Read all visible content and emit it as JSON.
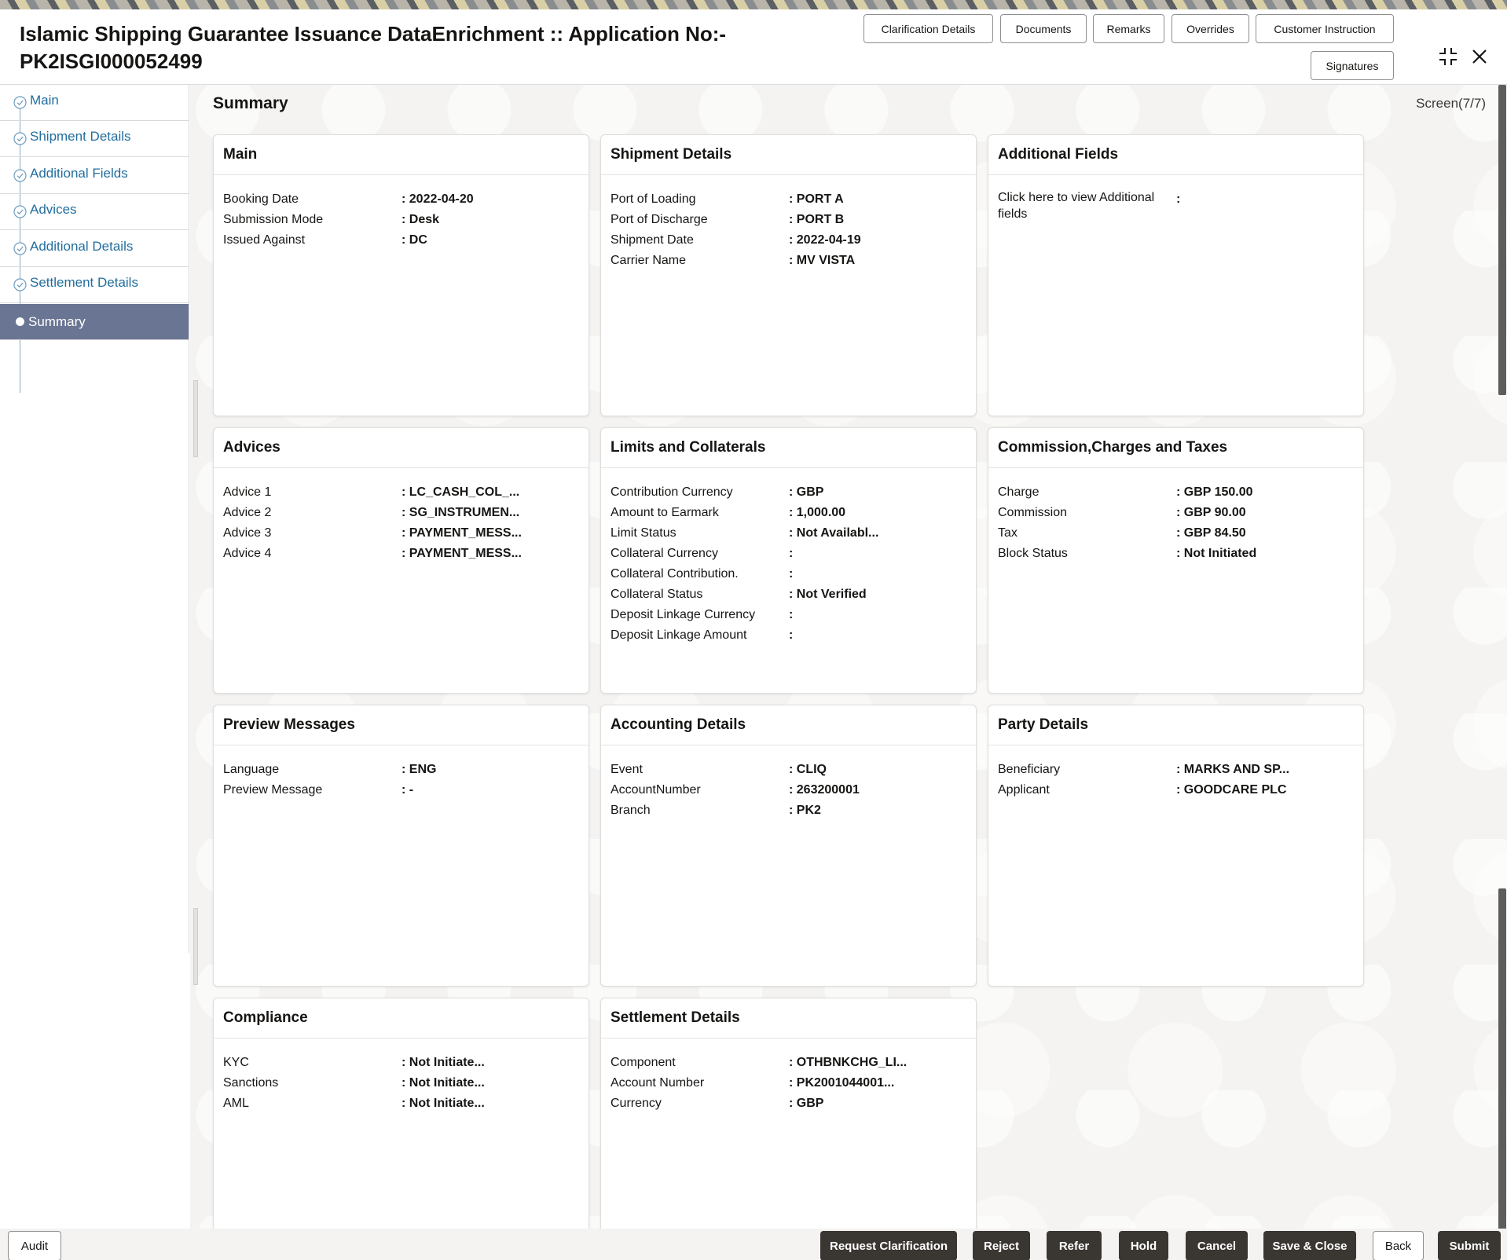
{
  "header": {
    "title_line1": "Islamic Shipping Guarantee Issuance DataEnrichment :: Application No:-",
    "title_line2": "PK2ISGI000052499",
    "buttons": {
      "clarification": "Clarification Details",
      "documents": "Documents",
      "remarks": "Remarks",
      "overrides": "Overrides",
      "customer_instruction": "Customer Instruction",
      "signatures": "Signatures"
    }
  },
  "sidebar": {
    "items": [
      {
        "label": "Main"
      },
      {
        "label": "Shipment Details"
      },
      {
        "label": "Additional Fields"
      },
      {
        "label": "Advices"
      },
      {
        "label": "Additional Details"
      },
      {
        "label": "Settlement Details"
      },
      {
        "label": "Summary"
      }
    ]
  },
  "page": {
    "title": "Summary",
    "screen_indicator": "Screen(7/7)"
  },
  "cards": {
    "main": {
      "title": "Main",
      "rows": [
        {
          "label": "Booking Date",
          "value": ": 2022-04-20"
        },
        {
          "label": "Submission Mode",
          "value": ": Desk"
        },
        {
          "label": "Issued Against",
          "value": ": DC"
        }
      ]
    },
    "shipment": {
      "title": "Shipment Details",
      "rows": [
        {
          "label": "Port of Loading",
          "value": ": PORT A"
        },
        {
          "label": "Port of Discharge",
          "value": ": PORT B"
        },
        {
          "label": "Shipment Date",
          "value": ": 2022-04-19"
        },
        {
          "label": "Carrier Name",
          "value": ": MV VISTA"
        }
      ]
    },
    "additional_fields": {
      "title": "Additional Fields",
      "rows": [
        {
          "label": "Click here to view Additional fields",
          "value": ":"
        }
      ]
    },
    "advices": {
      "title": "Advices",
      "rows": [
        {
          "label": "Advice 1",
          "value": ": LC_CASH_COL_..."
        },
        {
          "label": "Advice 2",
          "value": ": SG_INSTRUMEN..."
        },
        {
          "label": "Advice 3",
          "value": ": PAYMENT_MESS..."
        },
        {
          "label": "Advice 4",
          "value": ": PAYMENT_MESS..."
        }
      ]
    },
    "limits": {
      "title": "Limits and Collaterals",
      "rows": [
        {
          "label": "Contribution Currency",
          "value": ": GBP"
        },
        {
          "label": "Amount to Earmark",
          "value": ": 1,000.00"
        },
        {
          "label": "Limit Status",
          "value": ": Not Availabl..."
        },
        {
          "label": "Collateral Currency",
          "value": ":"
        },
        {
          "label": "Collateral Contribution.",
          "value": ":"
        },
        {
          "label": "Collateral Status",
          "value": ": Not Verified"
        },
        {
          "label": "Deposit Linkage Currency",
          "value": ":"
        },
        {
          "label": "Deposit Linkage Amount",
          "value": ":"
        }
      ]
    },
    "commission": {
      "title": "Commission,Charges and Taxes",
      "rows": [
        {
          "label": "Charge",
          "value": ": GBP  150.00"
        },
        {
          "label": "Commission",
          "value": ": GBP  90.00"
        },
        {
          "label": "Tax",
          "value": ": GBP  84.50"
        },
        {
          "label": "Block Status",
          "value": ": Not Initiated"
        }
      ]
    },
    "preview": {
      "title": "Preview Messages",
      "rows": [
        {
          "label": "Language",
          "value": ": ENG"
        },
        {
          "label": "Preview Message",
          "value": ": -"
        }
      ]
    },
    "accounting": {
      "title": "Accounting Details",
      "rows": [
        {
          "label": "Event",
          "value": ": CLIQ"
        },
        {
          "label": "AccountNumber",
          "value": ": 263200001"
        },
        {
          "label": "Branch",
          "value": ": PK2"
        }
      ]
    },
    "party": {
      "title": "Party Details",
      "rows": [
        {
          "label": "Beneficiary",
          "value": ": MARKS AND SP..."
        },
        {
          "label": "Applicant",
          "value": ": GOODCARE PLC"
        }
      ]
    },
    "compliance": {
      "title": "Compliance",
      "rows": [
        {
          "label": "KYC",
          "value": ": Not Initiate..."
        },
        {
          "label": "Sanctions",
          "value": ": Not Initiate..."
        },
        {
          "label": "AML",
          "value": ": Not Initiate..."
        }
      ]
    },
    "settlement": {
      "title": "Settlement Details",
      "rows": [
        {
          "label": "Component",
          "value": ": OTHBNKCHG_LI..."
        },
        {
          "label": "Account Number",
          "value": ": PK2001044001..."
        },
        {
          "label": "Currency",
          "value": ": GBP"
        }
      ]
    }
  },
  "footer": {
    "audit": "Audit",
    "request_clarification": "Request Clarification",
    "reject": "Reject",
    "refer": "Refer",
    "hold": "Hold",
    "cancel": "Cancel",
    "save_close": "Save & Close",
    "back": "Back",
    "submit": "Submit"
  },
  "icons": {
    "compress": "compress-icon",
    "close": "close-icon",
    "step_done": "check-circle-icon",
    "step_current": "dot-icon"
  },
  "colors": {
    "nav_link": "#226e9e",
    "nav_active_bg": "#697592",
    "primary_button": "#3a3632"
  }
}
